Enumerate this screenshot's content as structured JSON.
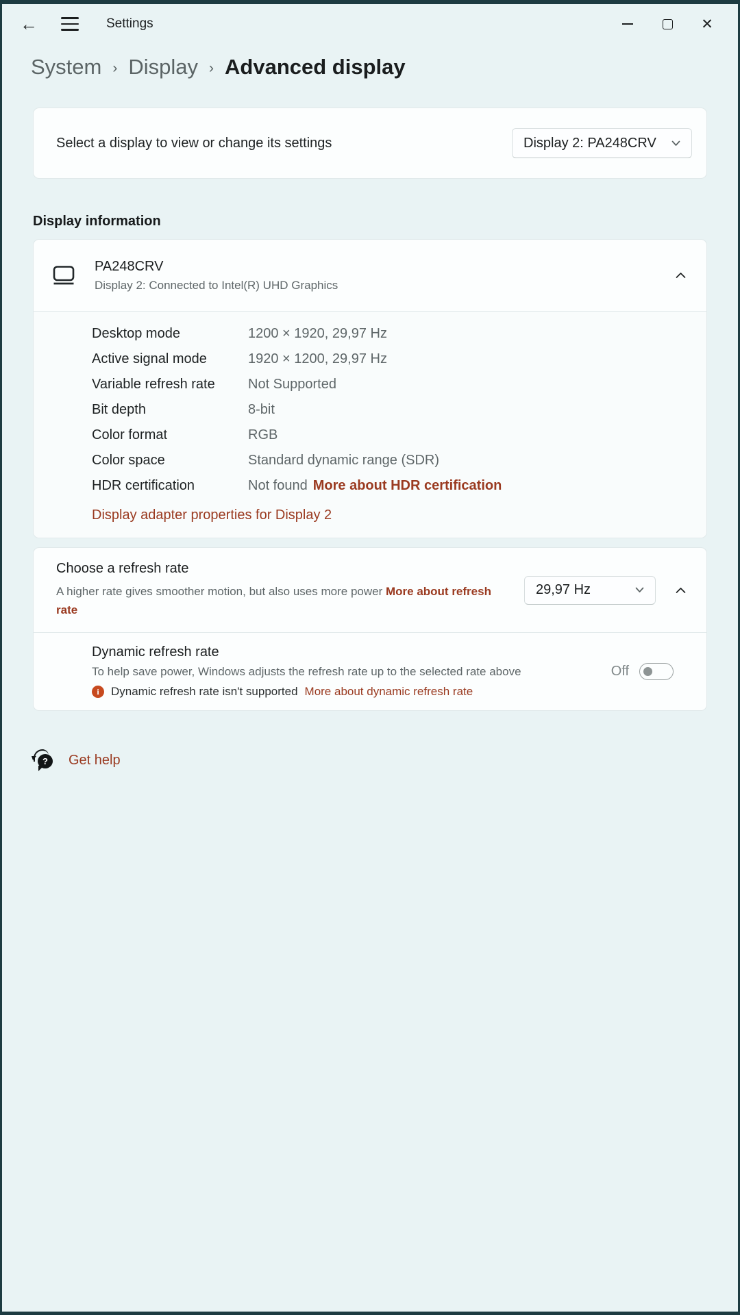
{
  "colors": {
    "frame": "#1d3b41",
    "page_bg": "#e9f3f4",
    "card_bg": "#fcfefe",
    "accent_link": "#9a3a20",
    "warning_icon": "#c74a1f",
    "text_primary": "#1b1e1f",
    "text_secondary": "#5e6668"
  },
  "icons": {
    "back": "←",
    "close": "✕",
    "breadcrumb_separator": "›",
    "breadcrumb_separator2": "›",
    "info_glyph": "i",
    "question_glyph": "?"
  },
  "titlebar": {
    "app_title": "Settings"
  },
  "breadcrumb": {
    "items": [
      "System",
      "Display",
      "Advanced display"
    ]
  },
  "display_selector": {
    "label": "Select a display to view or change its settings",
    "value": "Display 2: PA248CRV"
  },
  "display_information": {
    "section_title": "Display information",
    "device_name": "PA248CRV",
    "device_subtitle": "Display 2: Connected to Intel(R) UHD Graphics",
    "details": [
      {
        "label": "Desktop mode",
        "value": "1200 × 1920, 29,97 Hz"
      },
      {
        "label": "Active signal mode",
        "value": "1920 × 1200, 29,97 Hz"
      },
      {
        "label": "Variable refresh rate",
        "value": "Not Supported"
      },
      {
        "label": "Bit depth",
        "value": "8-bit"
      },
      {
        "label": "Color format",
        "value": "RGB"
      },
      {
        "label": "Color space",
        "value": "Standard dynamic range (SDR)"
      },
      {
        "label": "HDR certification",
        "value": "Not found",
        "link": "More about HDR certification"
      }
    ],
    "adapter_link": "Display adapter properties for Display 2"
  },
  "refresh_rate": {
    "title": "Choose a refresh rate",
    "description": "A higher rate gives smoother motion, but also uses more power",
    "link": "More about refresh rate",
    "value": "29,97 Hz",
    "dynamic": {
      "title": "Dynamic refresh rate",
      "description": "To help save power, Windows adjusts the refresh rate up to the selected rate above",
      "warning": "Dynamic refresh rate isn't supported",
      "warning_link": "More about dynamic refresh rate",
      "toggle_label": "Off"
    }
  },
  "get_help": {
    "label": "Get help"
  }
}
